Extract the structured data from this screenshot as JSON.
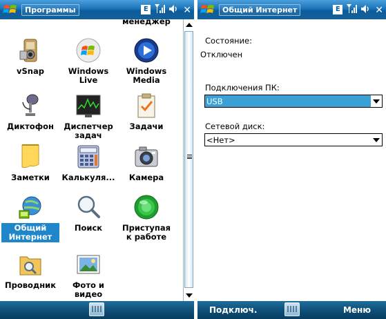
{
  "left_screen": {
    "title": "Программы",
    "status_icons": [
      "e-icon",
      "signal-icon",
      "volume-icon",
      "close-icon"
    ],
    "status_e": "E",
    "close_label": "✕",
    "partial_top_label": "менеджер",
    "programs": [
      {
        "id": "vsnap",
        "label": "vSnap",
        "icon": "vsnap-icon"
      },
      {
        "id": "windows-live",
        "label": "Windows Live",
        "icon": "windows-live-icon"
      },
      {
        "id": "windows-media",
        "label": "Windows Media",
        "icon": "windows-media-icon"
      },
      {
        "id": "dictophone",
        "label": "Диктофон",
        "icon": "microphone-icon"
      },
      {
        "id": "task-manager",
        "label": "Диспетчер задач",
        "icon": "task-manager-icon"
      },
      {
        "id": "tasks",
        "label": "Задачи",
        "icon": "tasks-clipboard-icon"
      },
      {
        "id": "notes",
        "label": "Заметки",
        "icon": "notes-icon"
      },
      {
        "id": "calculator",
        "label": "Калькуля...",
        "icon": "calculator-icon"
      },
      {
        "id": "camera",
        "label": "Камера",
        "icon": "camera-icon"
      },
      {
        "id": "internet-sharing",
        "label": "Общий Интернет",
        "icon": "internet-sharing-icon",
        "selected": true
      },
      {
        "id": "search",
        "label": "Поиск",
        "icon": "magnifier-icon"
      },
      {
        "id": "getting-started",
        "label": "Приступая к работе",
        "icon": "getting-started-icon"
      },
      {
        "id": "explorer",
        "label": "Проводник",
        "icon": "explorer-icon"
      },
      {
        "id": "photos-videos",
        "label": "Фото и видео",
        "icon": "photos-videos-icon"
      }
    ],
    "softbar": {
      "keyboard_icon": "keyboard-icon"
    }
  },
  "right_screen": {
    "title": "Общий Интернет",
    "status_e": "E",
    "close_label": "✕",
    "status_label": "Состояние:",
    "status_value": "Отключен",
    "pc_connection_label": "Подключения ПК:",
    "pc_connection_value": "USB",
    "network_card_label": "Сетевой диск:",
    "network_card_value": "<Нет>",
    "softbar": {
      "left": "Подключ.",
      "right": "Меню",
      "keyboard_icon": "keyboard-icon"
    }
  },
  "colors": {
    "title_bar": "#1c74b8",
    "soft_bar": "#0f5079",
    "selection": "#1f86c9",
    "dropdown_active": "#3aa0d6"
  }
}
